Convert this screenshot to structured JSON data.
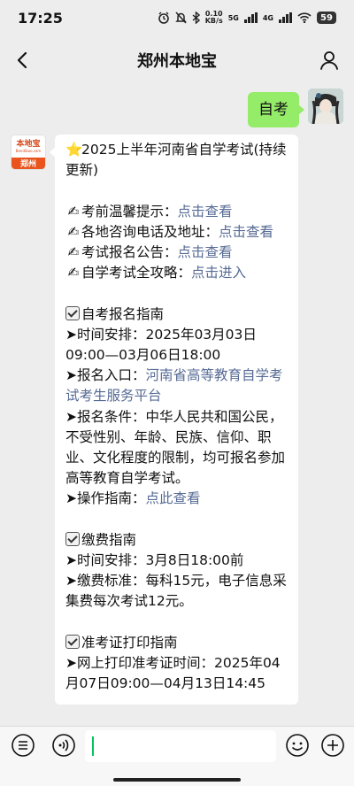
{
  "status": {
    "time": "17:25",
    "speed_value": "0.10",
    "speed_unit": "KB/s",
    "net_label_1": "5G",
    "net_label_2": "4G",
    "battery": "59"
  },
  "nav": {
    "title": "郑州本地宝",
    "back_icon": "chevron-left-icon",
    "profile_icon": "person-icon"
  },
  "chat": {
    "outgoing": {
      "text": "自考"
    },
    "incoming_avatar": {
      "brand_name": "本地宝",
      "brand_url": "Bendibao.com",
      "city": "郑州"
    },
    "message": {
      "title": "2025上半年河南省自学考试(持续更新)",
      "star_emoji": "⭐",
      "hand_emoji": "✍",
      "arrow": "➤",
      "tips": [
        {
          "label": "考前温馨提示：",
          "link": "点击查看"
        },
        {
          "label": "各地咨询电话及地址：",
          "link": "点击查看"
        },
        {
          "label": "考试报名公告：",
          "link": "点击查看"
        },
        {
          "label": "自学考试全攻略：",
          "link": "点击进入"
        }
      ],
      "section1": {
        "heading": "自考报名指南",
        "time_label": "时间安排：2025年03月03日09:00—03月06日18:00",
        "entry_label": "报名入口：",
        "entry_link": "河南省高等教育自学考试考生服务平台",
        "conditions": "报名条件：中华人民共和国公民，不受性别、年龄、民族、信仰、职业、文化程度的限制，均可报名参加高等教育自学考试。",
        "guide_label": "操作指南：",
        "guide_link": "点此查看"
      },
      "section2": {
        "heading": "缴费指南",
        "time_label": "时间安排：3月8日18:00前",
        "fee_label": "缴费标准：每科15元，电子信息采集费每次考试12元。"
      },
      "section3": {
        "heading": "准考证打印指南",
        "print_label": "网上打印准考证时间：2025年04月07日09:00—04月13日14:45"
      }
    }
  },
  "input_bar": {
    "menu_icon": "list-menu-icon",
    "voice_icon": "voice-icon",
    "emoji_icon": "emoji-icon",
    "add_icon": "plus-icon"
  }
}
